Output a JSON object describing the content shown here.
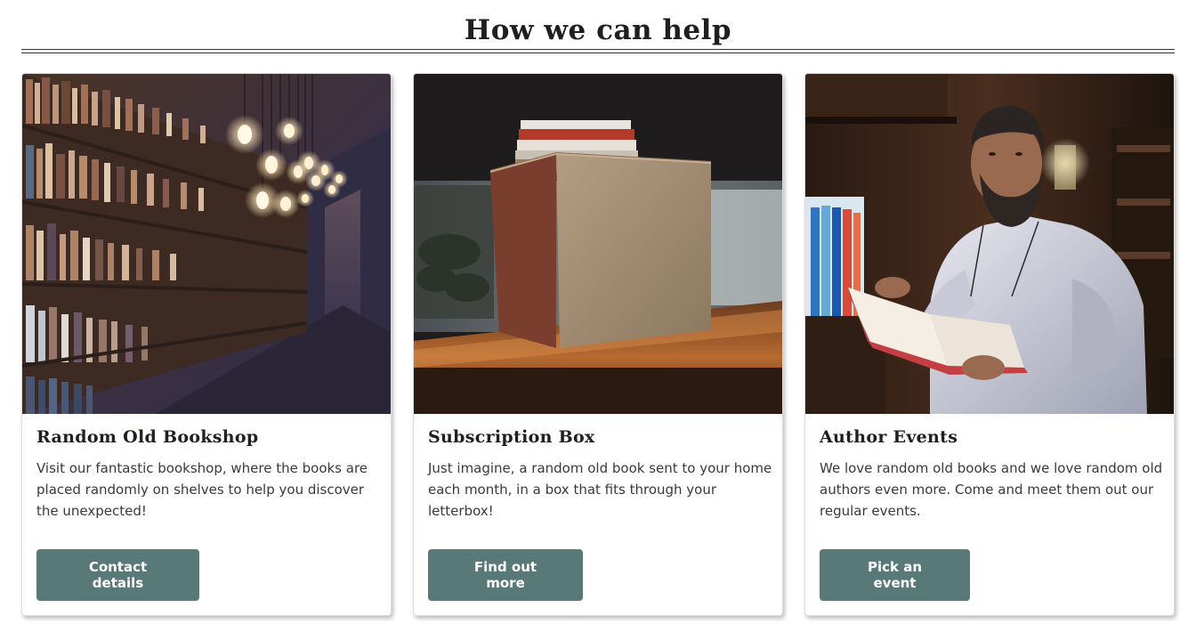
{
  "section": {
    "title": "How we can help"
  },
  "cards": [
    {
      "title": "Random Old Bookshop",
      "text": "Visit our fantastic bookshop, where the books are placed randomly on shelves to help you discover the unexpected!",
      "button_label": "Contact details",
      "image": "bookshop-shelves-photo"
    },
    {
      "title": "Subscription Box",
      "text": "Just imagine, a random old book sent to your home each month, in a box that fits through your letterbox!",
      "button_label": "Find out more",
      "image": "cardboard-box-photo"
    },
    {
      "title": "Author Events",
      "text": "We love random old books and we love random old authors even more. Come and meet them out our regular events.",
      "button_label": "Pick an event",
      "image": "man-reading-book-photo"
    }
  ],
  "colors": {
    "button": "#587977",
    "button_text": "#ffffff",
    "heading": "#1f1f1f",
    "body_text": "#3a3a3a"
  }
}
